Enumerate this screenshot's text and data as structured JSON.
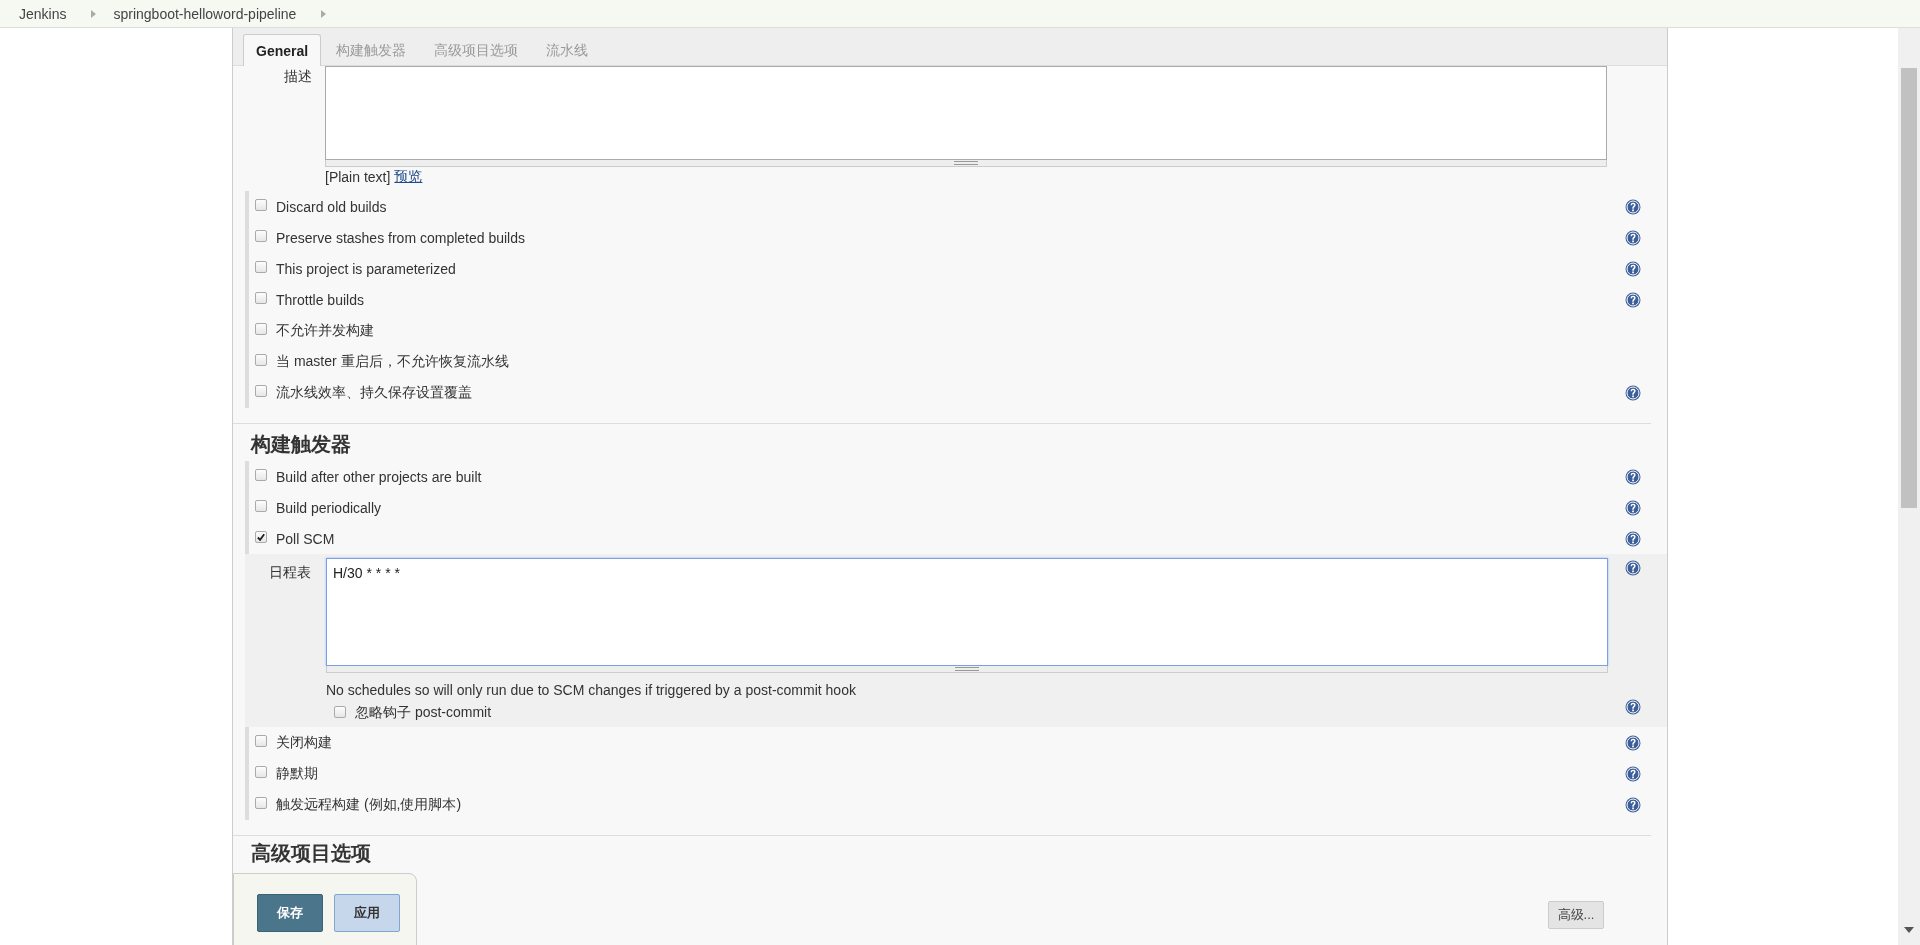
{
  "breadcrumbs": [
    {
      "label": "Jenkins"
    },
    {
      "label": "springboot-helloword-pipeline"
    }
  ],
  "tabs": [
    {
      "label": "General",
      "selected": true
    },
    {
      "label": "构建触发器",
      "selected": false
    },
    {
      "label": "高级项目选项",
      "selected": false
    },
    {
      "label": "流水线",
      "selected": false
    }
  ],
  "description": {
    "label": "描述",
    "format_note": "[Plain text]",
    "preview_link": "预览"
  },
  "general_options": [
    {
      "label": "Discard old builds",
      "checked": false,
      "help": true
    },
    {
      "label": "Preserve stashes from completed builds",
      "checked": false,
      "help": true
    },
    {
      "label": "This project is parameterized",
      "checked": false,
      "help": true
    },
    {
      "label": "Throttle builds",
      "checked": false,
      "help": true
    },
    {
      "label": "不允许并发构建",
      "checked": false,
      "help": false
    },
    {
      "label": "当 master 重启后，不允许恢复流水线",
      "checked": false,
      "help": false
    },
    {
      "label": "流水线效率、持久保存设置覆盖",
      "checked": false,
      "help": true
    }
  ],
  "build_triggers": {
    "title": "构建触发器",
    "options": [
      {
        "label": "Build after other projects are built",
        "checked": false,
        "help": true
      },
      {
        "label": "Build periodically",
        "checked": false,
        "help": true
      },
      {
        "label": "Poll SCM",
        "checked": true,
        "help": true,
        "schedule": {
          "label": "日程表",
          "value": "H/30 * * * *",
          "focused": true,
          "help": true,
          "hint": "No schedules so will only run due to SCM changes if triggered by a post-commit hook",
          "ignore_post_commit": {
            "label": "忽略钩子 post-commit",
            "checked": false,
            "help": true
          }
        }
      },
      {
        "label": "关闭构建",
        "checked": false,
        "help": true
      },
      {
        "label": "静默期",
        "checked": false,
        "help": true
      },
      {
        "label": "触发远程构建 (例如,使用脚本)",
        "checked": false,
        "help": true
      }
    ]
  },
  "advanced_project_options": {
    "title": "高级项目选项",
    "advanced_button": "高级..."
  },
  "actions": [
    {
      "label": "保存",
      "kind": "primary"
    },
    {
      "label": "应用",
      "kind": "secondary"
    }
  ]
}
